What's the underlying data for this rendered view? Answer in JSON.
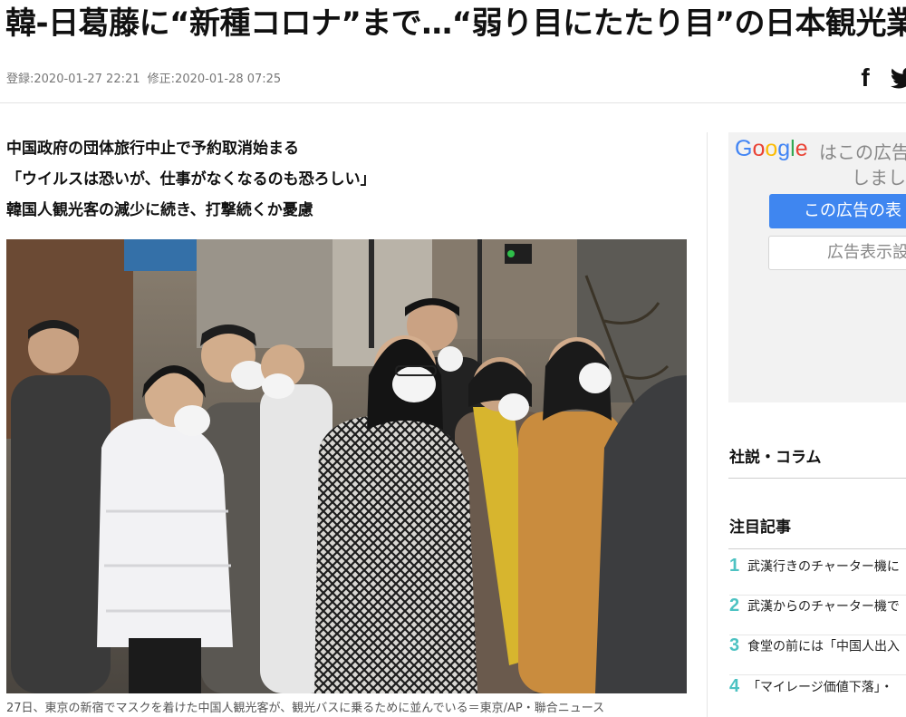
{
  "article": {
    "headline": "韓-日葛藤に“新種コロナ”まで…“弱り目にたたり目”の日本観光業界",
    "registered": "登録:2020-01-27 22:21",
    "modified": "修正:2020-01-28 07:25",
    "share": {
      "facebook_icon": "f",
      "twitter_icon": "twitter-bird"
    },
    "subheads": [
      "中国政府の団体旅行中止で予約取消始まる",
      "「ウイルスは恐いが、仕事がなくなるのも恐ろしい」",
      "韓国人観光客の減少に続き、打撃続くか憂慮"
    ],
    "photo_caption": "27日、東京の新宿でマスクを着けた中国人観光客が、観光バスに乗るために並んでいる＝東京/AP・聯合ニュース"
  },
  "sidebar": {
    "ad": {
      "google_letters": [
        "G",
        "o",
        "o",
        "g",
        "l",
        "e"
      ],
      "google_colors": [
        "#4285f4",
        "#ea4335",
        "#fbbc05",
        "#4285f4",
        "#34a853",
        "#ea4335"
      ],
      "text_line1": "はこの広告",
      "text_line2": "しまし",
      "primary_button": "この広告の表",
      "secondary_button": "広告表示設"
    },
    "opinion_title": "社説・コラム",
    "popular_title": "注目記事",
    "popular_items": [
      {
        "num": "1",
        "text": "武漢行きのチャーター機に"
      },
      {
        "num": "2",
        "text": "武漢からのチャーター機で"
      },
      {
        "num": "3",
        "text": "食堂の前には「中国人出入"
      },
      {
        "num": "4",
        "text": "「マイレージ価値下落」・"
      }
    ],
    "accent_color": "#4dc2c2"
  }
}
